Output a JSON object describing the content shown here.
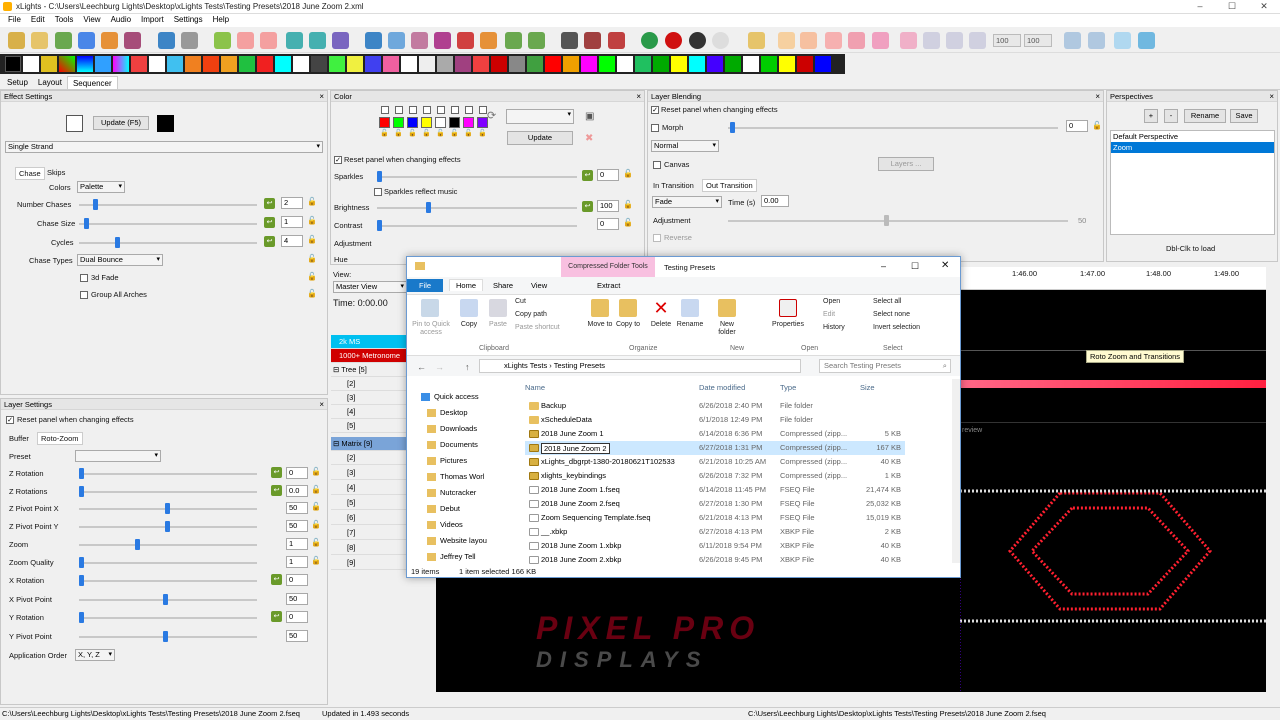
{
  "window": {
    "title": "xLights - C:\\Users\\Leechburg Lights\\Desktop\\xLights Tests\\Testing Presets\\2018 June Zoom 2.xml",
    "controls": [
      "–",
      "☐",
      "✕"
    ]
  },
  "menu": [
    "File",
    "Edit",
    "Tools",
    "View",
    "Audio",
    "Import",
    "Settings",
    "Help"
  ],
  "toolbar": {
    "zoom1": "100",
    "zoom2": "100"
  },
  "tabs": [
    "Setup",
    "Layout",
    "Sequencer"
  ],
  "effect_settings": {
    "title": "Effect Settings",
    "update_label": "Update (F5)",
    "effect": "Single Strand",
    "subtabs": [
      "Chase",
      "Skips"
    ],
    "colors_label": "Colors",
    "colors_value": "Palette",
    "num_chases_label": "Number Chases",
    "num_chases": "2",
    "chase_size_label": "Chase Size",
    "chase_size": "1",
    "cycles_label": "Cycles",
    "cycles": "4",
    "chase_types_label": "Chase Types",
    "chase_types": "Dual Bounce",
    "fade_label": "3d Fade",
    "group_label": "Group All Arches"
  },
  "layer_settings": {
    "title": "Layer Settings",
    "reset_label": "Reset panel when changing effects",
    "subtabs": [
      "Buffer",
      "Roto-Zoom"
    ],
    "preset_label": "Preset",
    "rows": [
      {
        "label": "Z Rotation",
        "value": "0"
      },
      {
        "label": "Z Rotations",
        "value": "0.0"
      },
      {
        "label": "Z Pivot Point X",
        "value": "50"
      },
      {
        "label": "Z Pivot Point Y",
        "value": "50"
      },
      {
        "label": "Zoom",
        "value": "1"
      },
      {
        "label": "Zoom Quality",
        "value": "1"
      },
      {
        "label": "X Rotation",
        "value": "0"
      },
      {
        "label": "X Pivot Point",
        "value": "50"
      },
      {
        "label": "Y Rotation",
        "value": "0"
      },
      {
        "label": "Y Pivot Point",
        "value": "50"
      }
    ],
    "order_label": "Application Order",
    "order_value": "X, Y, Z"
  },
  "color": {
    "title": "Color",
    "update_label": "Update",
    "reset_label": "Reset panel when changing effects",
    "sparkles_label": "Sparkles",
    "sparkles": "0",
    "sparkles_music": "Sparkles reflect music",
    "brightness_label": "Brightness",
    "brightness": "100",
    "contrast_label": "Contrast",
    "contrast": "0",
    "adjustment_label": "Adjustment",
    "hue_label": "Hue",
    "palette": [
      "#ff0000",
      "#00ff00",
      "#0000ff",
      "#ffff00",
      "#ffffff",
      "#000000",
      "#ff00ff",
      "#8000ff"
    ]
  },
  "layer_blending": {
    "title": "Layer Blending",
    "reset_label": "Reset panel when changing effects",
    "morph_label": "Morph",
    "morph_value": "0",
    "blend_mode": "Normal",
    "canvas_label": "Canvas",
    "layers_label": "Layers ...",
    "tabs": [
      "In Transition",
      "Out Transition"
    ],
    "transition": "Fade",
    "time_label": "Time (s)",
    "time": "0.00",
    "adjustment_label": "Adjustment",
    "adjustment": "50",
    "reverse_label": "Reverse"
  },
  "perspectives": {
    "title": "Perspectives",
    "plus": "+",
    "minus": "-",
    "rename": "Rename",
    "save": "Save",
    "items": [
      "Default Perspective",
      "Zoom"
    ],
    "hint": "Dbl-Clk to load"
  },
  "view": {
    "label": "View:",
    "value": "Master View",
    "time": "Time: 0:00.00"
  },
  "tree": {
    "items": [
      "2k MS",
      "1000+ Metronome",
      "Tree [5]",
      "[2]",
      "[3]",
      "[4]",
      "[5]",
      "Matrix [9]",
      "[2]",
      "[3]",
      "[4]",
      "[5]",
      "[6]",
      "[7]",
      "[8]",
      "[9]"
    ]
  },
  "timeline": {
    "ticks": [
      "1:46.00",
      "1:47.00",
      "1:48.00",
      "1:49.00"
    ],
    "effect_label": "Roto Zoom and Transitions",
    "preview": "review"
  },
  "explorer": {
    "tool_tab": "Compressed Folder Tools",
    "title": "Testing Presets",
    "tabs": [
      "File",
      "Home",
      "Share",
      "View",
      "Extract"
    ],
    "clipboard": {
      "pin": "Pin to Quick access",
      "copy": "Copy",
      "paste": "Paste",
      "cut": "Cut",
      "copy_path": "Copy path",
      "paste_shortcut": "Paste shortcut",
      "group": "Clipboard"
    },
    "organize": {
      "move": "Move to",
      "copy": "Copy to",
      "delete": "Delete",
      "rename": "Rename",
      "group": "Organize"
    },
    "new": {
      "folder": "New folder",
      "group": "New"
    },
    "open": {
      "props": "Properties",
      "open": "Open",
      "edit": "Edit",
      "history": "History",
      "group": "Open"
    },
    "select": {
      "all": "Select all",
      "none": "Select none",
      "invert": "Invert selection",
      "group": "Select"
    },
    "path": [
      "xLights Tests",
      "Testing Presets"
    ],
    "search": "Search Testing Presets",
    "cols": [
      "Name",
      "Date modified",
      "Type",
      "Size"
    ],
    "nav": [
      "Quick access",
      "Desktop",
      "Downloads",
      "Documents",
      "Pictures",
      "Thomas Worl",
      "Nutcracker",
      "Debut",
      "Videos",
      "Website layou",
      "Jeffrey Tell"
    ],
    "files": [
      {
        "name": "Backup",
        "date": "6/26/2018 2:40 PM",
        "type": "File folder",
        "size": "",
        "kind": "folder"
      },
      {
        "name": "xScheduleData",
        "date": "6/1/2018 12:49 PM",
        "type": "File folder",
        "size": "",
        "kind": "folder"
      },
      {
        "name": "2018 June Zoom 1",
        "date": "6/14/2018 6:36 PM",
        "type": "Compressed (zipp...",
        "size": "5 KB",
        "kind": "zip"
      },
      {
        "name": "2018 June Zoom 2",
        "date": "6/27/2018 1:31 PM",
        "type": "Compressed (zipp...",
        "size": "167 KB",
        "kind": "zip"
      },
      {
        "name": "xLights_dbgrpt-1380-20180621T102533",
        "date": "6/21/2018 10:25 AM",
        "type": "Compressed (zipp...",
        "size": "40 KB",
        "kind": "zip"
      },
      {
        "name": "xlights_keybindings",
        "date": "6/26/2018 7:32 PM",
        "type": "Compressed (zipp...",
        "size": "1 KB",
        "kind": "zip"
      },
      {
        "name": "2018 June Zoom 1.fseq",
        "date": "6/14/2018 11:45 PM",
        "type": "FSEQ File",
        "size": "21,474 KB",
        "kind": "file"
      },
      {
        "name": "2018 June Zoom 2.fseq",
        "date": "6/27/2018 1:30 PM",
        "type": "FSEQ File",
        "size": "25,032 KB",
        "kind": "file"
      },
      {
        "name": "Zoom Sequencing Template.fseq",
        "date": "6/21/2018 4:13 PM",
        "type": "FSEQ File",
        "size": "15,019 KB",
        "kind": "file"
      },
      {
        "name": "__.xbkp",
        "date": "6/27/2018 4:13 PM",
        "type": "XBKP File",
        "size": "2 KB",
        "kind": "file"
      },
      {
        "name": "2018 June Zoom 1.xbkp",
        "date": "6/11/2018 9:54 PM",
        "type": "XBKP File",
        "size": "40 KB",
        "kind": "file"
      },
      {
        "name": "2018 June Zoom 2.xbkp",
        "date": "6/26/2018 9:45 PM",
        "type": "XBKP File",
        "size": "40 KB",
        "kind": "file"
      }
    ],
    "status_items": "19 items",
    "status_sel": "1 item selected 166 KB"
  },
  "watermark": {
    "top": "PIXEL PRO",
    "bottom": "DISPLAYS"
  },
  "status": {
    "left": "C:\\Users\\Leechburg Lights\\Desktop\\xLights Tests\\Testing Presets\\2018 June Zoom 2.fseq",
    "updated": "Updated in 1.493 seconds",
    "right": "C:\\Users\\Leechburg Lights\\Desktop\\xLights Tests\\Testing Presets\\2018 June Zoom 2.fseq"
  }
}
